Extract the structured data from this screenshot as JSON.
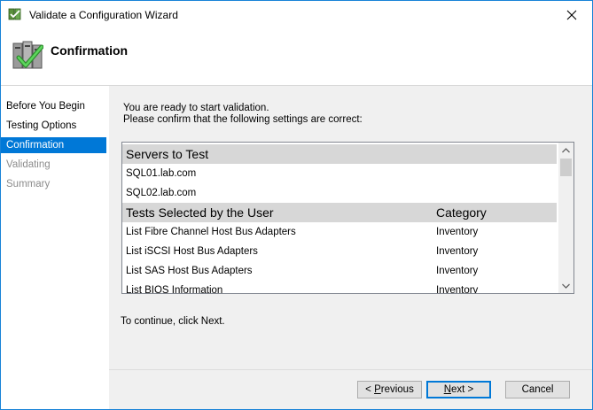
{
  "window": {
    "title": "Validate a Configuration Wizard"
  },
  "header": {
    "title": "Confirmation"
  },
  "nav": {
    "items": [
      {
        "label": "Before You Begin",
        "state": "normal"
      },
      {
        "label": "Testing Options",
        "state": "normal"
      },
      {
        "label": "Confirmation",
        "state": "active"
      },
      {
        "label": "Validating",
        "state": "disabled"
      },
      {
        "label": "Summary",
        "state": "disabled"
      }
    ]
  },
  "main": {
    "intro_line1": "You are ready to start validation.",
    "intro_line2": "Please confirm that the following settings are correct:",
    "continue_text": "To continue, click Next."
  },
  "list": {
    "servers_header": "Servers to Test",
    "servers": [
      "SQL01.lab.com",
      "SQL02.lab.com"
    ],
    "tests_header": "Tests Selected by the User",
    "category_header": "Category",
    "tests": [
      {
        "name": "List Fibre Channel Host Bus Adapters",
        "category": "Inventory"
      },
      {
        "name": "List iSCSI Host Bus Adapters",
        "category": "Inventory"
      },
      {
        "name": "List SAS Host Bus Adapters",
        "category": "Inventory"
      },
      {
        "name": "List BIOS Information",
        "category": "Inventory"
      }
    ]
  },
  "buttons": {
    "previous": {
      "accel": "P",
      "rest": "revious",
      "prefix": "< "
    },
    "next": {
      "accel": "N",
      "rest": "ext >"
    },
    "cancel": "Cancel"
  },
  "colors": {
    "selection": "#0078d7",
    "section_bg": "#d7d7d7",
    "panel_bg": "#f0f0f0"
  },
  "icons": {
    "app": "cluster-validate-icon",
    "close": "close-icon",
    "header": "cluster-check-icon"
  }
}
